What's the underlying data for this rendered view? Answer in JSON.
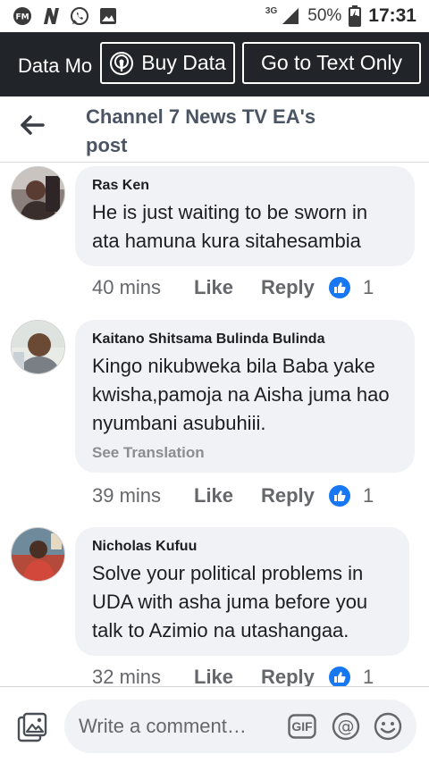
{
  "status_bar": {
    "icons": [
      "fm-radio-icon",
      "n-notification-icon",
      "whatsapp-icon",
      "image-notification-icon"
    ],
    "network": "3G",
    "battery": "50%",
    "time": "17:31"
  },
  "data_bar": {
    "label": "Data Mo",
    "buy_data": "Buy Data",
    "text_only": "Go to Text Only"
  },
  "header": {
    "title": "Channel 7 News TV EA's post"
  },
  "comments": [
    {
      "name": "Ras Ken",
      "text": "He is just waiting to be sworn in ata hamuna kura sitahesambia",
      "see_translation": "",
      "time": "40 mins",
      "like": "Like",
      "reply": "Reply",
      "reactions": "1"
    },
    {
      "name": "Kaitano Shitsama Bulinda Bulinda",
      "text": "Kingo nikubweka bila Baba yake kwisha,pamoja na Aisha juma hao nyumbani asubuhiii.",
      "see_translation": "See Translation",
      "time": "39 mins",
      "like": "Like",
      "reply": "Reply",
      "reactions": "1"
    },
    {
      "name": "Nicholas Kufuu",
      "text": "Solve your political problems in UDA with asha juma before you talk to Azimio na utashangaa.",
      "see_translation": "",
      "time": "32 mins",
      "like": "Like",
      "reply": "Reply",
      "reactions": "1"
    }
  ],
  "composer": {
    "placeholder": "Write a comment…",
    "gif_label": "GIF"
  },
  "colors": {
    "dark_bar": "#212529",
    "bubble": "#f0f2f5",
    "like_blue": "#1877f2",
    "meta_grey": "#65676b"
  }
}
